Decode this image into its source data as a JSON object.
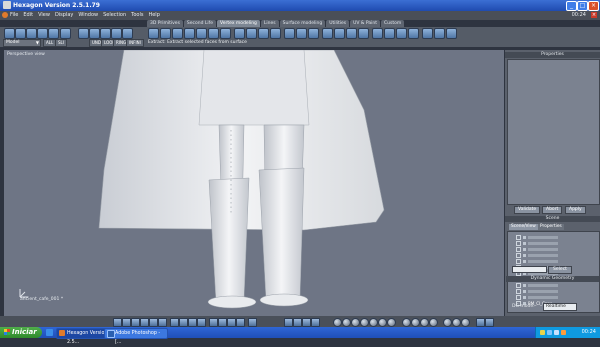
{
  "window": {
    "title": "Hexagon Version 2.5.1.79",
    "minimize": "_",
    "maximize": "□",
    "close": "×"
  },
  "menubar": {
    "items": [
      "File",
      "Edit",
      "View",
      "Display",
      "Window",
      "Selection",
      "Tools",
      "Help"
    ],
    "clock": "00:24",
    "close": "×"
  },
  "tabs": [
    {
      "label": "3D Primitives",
      "active": false
    },
    {
      "label": "Second Life",
      "active": false
    },
    {
      "label": "Vertex modeling",
      "active": true
    },
    {
      "label": "Lines",
      "active": false
    },
    {
      "label": "Surface modeling",
      "active": false
    },
    {
      "label": "Utilities",
      "active": false
    },
    {
      "label": "UV & Paint",
      "active": false
    },
    {
      "label": "Custom",
      "active": false
    }
  ],
  "toolbar": {
    "mode_select": "Model",
    "mini_labels": [
      "ALL",
      "UNDO",
      "LOOP",
      "RING",
      "INFINI",
      "SLI"
    ],
    "status_message": "Extract: Extract selected faces from surface"
  },
  "viewport": {
    "title": "Perspective view",
    "object_name": "ancient_cafe_001 *"
  },
  "properties": {
    "header": "Properties",
    "buttons": [
      "Validate",
      "Abort",
      "Apply"
    ]
  },
  "scene": {
    "header": "Scene",
    "tabs": [
      "Scene/View",
      "Properties"
    ],
    "selected_item": "BM_Cl_Cape",
    "select_button": "Select"
  },
  "dynamic_geometry": {
    "header": "Dynamic Geometry",
    "mode_label": "DG mode:",
    "mode_value": "Realtime"
  },
  "taskbar": {
    "start_label": "Iniciar",
    "tasks": [
      {
        "label": "Hexagon Version 2.5...",
        "active": true,
        "color": "#e07a2b"
      },
      {
        "label": "Adobe Photoshop - [...",
        "active": false,
        "color": "#2a5fb0"
      }
    ],
    "clock": "00:24"
  },
  "colors": {
    "viewport_bg": "#6e7585",
    "accent": "#3f7de8"
  }
}
